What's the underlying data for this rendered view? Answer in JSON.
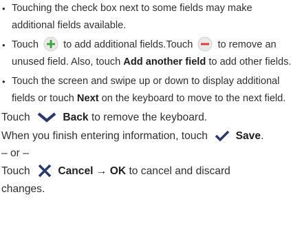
{
  "bullets": [
    {
      "line1": "Touching the check box next to some fields may make",
      "line2": "additional fields available."
    },
    {
      "line1_pre": "Touch",
      "line1_mid": "to add additional fields.Touch",
      "line1_post": "to remove an",
      "line2_pre": "unused field. Also, touch",
      "line2_bold": "Add another field",
      "line2_post": "to add other fields."
    },
    {
      "line1": "Touch the screen and swipe up or down to display additional",
      "line2_pre": "fields or touch",
      "line2_bold": "Next",
      "line2_post": "on the keyboard to move to the next field."
    }
  ],
  "para_back": {
    "pre": "Touch",
    "bold": "Back",
    "post": "to remove the keyboard."
  },
  "para_save": {
    "pre": "When you finish entering information, touch",
    "bold": "Save",
    "post": "."
  },
  "or_text": "– or –",
  "para_cancel": {
    "pre": "Touch",
    "bold1": "Cancel",
    "arrow": "→",
    "bold2": "OK",
    "post": "to cancel and discard",
    "line2": "changes."
  },
  "colors": {
    "text": "#2f2f2f",
    "add_icon": "#3aa635",
    "remove_icon": "#e0323a",
    "dark_icon": "#2b3a6b"
  },
  "icons": {
    "add": "plus-circle-icon",
    "remove": "minus-circle-icon",
    "back": "chevron-down-icon",
    "save": "checkmark-icon",
    "cancel": "x-icon"
  }
}
